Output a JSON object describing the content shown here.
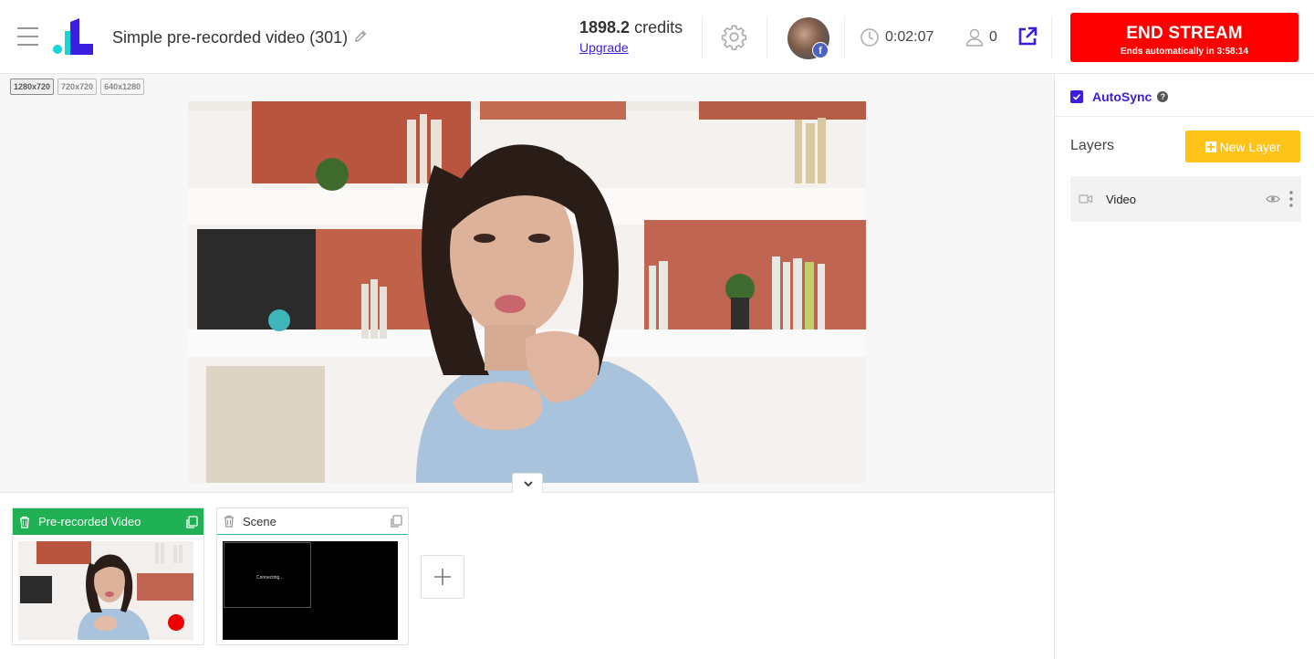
{
  "header": {
    "title": "Simple pre-recorded video (301)",
    "credits_value": "1898.2",
    "credits_unit": "credits",
    "upgrade_label": "Upgrade",
    "avatar_badge": "f",
    "timer": "0:02:07",
    "viewers": "0",
    "end_stream_label": "END STREAM",
    "end_stream_sub_prefix": "Ends automatically in",
    "end_stream_sub_time": "3:58:14"
  },
  "canvas": {
    "resolutions": [
      "1280x720",
      "720x720",
      "640x1280"
    ],
    "active_resolution": "1280x720"
  },
  "scenes": [
    {
      "label": "Pre-recorded Video",
      "active": true
    },
    {
      "label": "Scene",
      "active": false,
      "status_text": "Connecting..."
    }
  ],
  "right_panel": {
    "autosync_label": "AutoSync",
    "autosync_checked": true,
    "help_glyph": "?",
    "layers_title": "Layers",
    "new_layer_label": "New Layer",
    "layers": [
      {
        "name": "Video",
        "icon": "camera-icon"
      }
    ]
  },
  "colors": {
    "accent": "#3a1ee0",
    "end_stream": "#ff0000",
    "active_scene": "#1fb153",
    "new_layer": "#ffc417"
  }
}
